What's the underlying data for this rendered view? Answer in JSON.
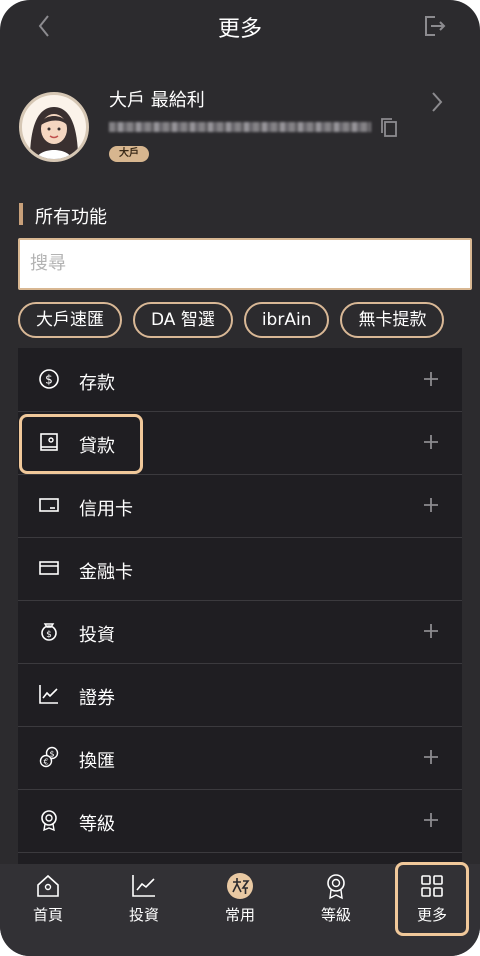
{
  "header": {
    "title": "更多",
    "back_icon": "chevron-left-icon",
    "logout_icon": "logout-icon"
  },
  "profile": {
    "name": "大戶 最給利",
    "account_masked": "",
    "tier_badge": "大戶",
    "copy_icon": "copy-icon",
    "avatar": "user-avatar"
  },
  "section": {
    "title": "所有功能"
  },
  "search": {
    "placeholder": "搜尋"
  },
  "chips": [
    {
      "label": "大戶速匯"
    },
    {
      "label": "DA 智選"
    },
    {
      "label": "ibrAin"
    },
    {
      "label": "無卡提款"
    }
  ],
  "menu": [
    {
      "label": "存款",
      "icon": "dollar-circle-icon",
      "expandable": true
    },
    {
      "label": "貸款",
      "icon": "loan-document-icon",
      "expandable": true
    },
    {
      "label": "信用卡",
      "icon": "credit-card-icon",
      "expandable": true
    },
    {
      "label": "金融卡",
      "icon": "debit-card-icon",
      "expandable": false
    },
    {
      "label": "投資",
      "icon": "money-bag-icon",
      "expandable": true
    },
    {
      "label": "證券",
      "icon": "line-chart-icon",
      "expandable": false
    },
    {
      "label": "換匯",
      "icon": "currency-exchange-icon",
      "expandable": true
    },
    {
      "label": "等級",
      "icon": "medal-icon",
      "expandable": true
    }
  ],
  "bottom_nav": [
    {
      "label": "首頁",
      "icon": "home-icon"
    },
    {
      "label": "投資",
      "icon": "trend-chart-icon"
    },
    {
      "label": "常用",
      "icon": "favorite-logo-icon"
    },
    {
      "label": "等級",
      "icon": "medal-icon"
    },
    {
      "label": "更多",
      "icon": "grid-icon",
      "active": true
    }
  ],
  "colors": {
    "background": "#2c2b2e",
    "menu_background": "#1f1e22",
    "accent": "#d8b792",
    "highlight": "#f0c89a",
    "icon": "#8c8b8f"
  }
}
